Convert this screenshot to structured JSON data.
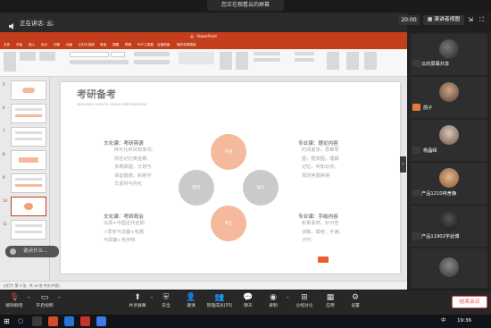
{
  "banner": {
    "text": "您正在观看云的屏幕"
  },
  "meeting": {
    "speaker_text": "正在讲话: 云;",
    "time": "20:00",
    "presenter_view": "演讲者视图",
    "fullscreen_icon": "fullscreen-icon"
  },
  "ppt": {
    "window_title": "云 - PowerPoint",
    "tabs": [
      "文件",
      "开始",
      "插入",
      "设计",
      "切换",
      "动画",
      "幻灯片放映",
      "审阅",
      "视图",
      "帮助",
      "PDF工具集",
      "百度网盘"
    ],
    "tell_me": "操作说明搜索",
    "user_badge": "我在讲话",
    "status_text": "幻灯片 第 9 张，共 16 张    中文(中国)",
    "thumbs": [
      "5",
      "6",
      "7",
      "8",
      "9",
      "10",
      "11"
    ]
  },
  "slide": {
    "title": "考研备考",
    "subtitle": "DEGASED FATHER GRING PREPARATION",
    "circles": {
      "top": "英语",
      "left": "政治",
      "right": "理论",
      "bottom": "专业"
    },
    "blocks": [
      {
        "title": "文化课：考研英语",
        "body": "碎片化时间背单词,\n抓住记忆黄金期,\n多刷真题，计划与\n保证题感，积累作\n文素材与内化"
      },
      {
        "title": "专业课：理论内容",
        "body": "时间紧张，思维导\n图，框架图，理解\n记忆，听知识点，\n规范答题用语"
      },
      {
        "title": "文化课：考研政治",
        "body": "马原+中国近代史纲\n+思修与法基+毛概\n与政策+毛中特"
      },
      {
        "title": "专业课：手绘内容",
        "body": "积累素材，针对性\n训练，模考，手速，\n计时"
      }
    ]
  },
  "overlay": {
    "speaking": "说点什么..."
  },
  "participants": [
    {
      "name": "云的屏幕共享",
      "color": "#2f2f2f"
    },
    {
      "name": "鸽子",
      "color": "#6b4f3b"
    },
    {
      "name": "杨晶晖",
      "color": "#8c6e5a"
    },
    {
      "name": "产品1210林舍静",
      "color": "#5b4536"
    },
    {
      "name": "产品11902宇此博",
      "color": "#2a2a2a"
    },
    {
      "name": "",
      "color": "#4d4d4d"
    }
  ],
  "toolbar": {
    "buttons": [
      {
        "label": "解除静音",
        "icon": "microphone-muted-icon"
      },
      {
        "label": "开启视频",
        "icon": "camera-off-icon"
      },
      {
        "label": "共享屏幕",
        "icon": "share-screen-icon"
      },
      {
        "label": "安全",
        "icon": "shield-icon"
      },
      {
        "label": "邀请",
        "icon": "invite-icon"
      },
      {
        "label": "管理成员(35)",
        "icon": "members-icon"
      },
      {
        "label": "聊天",
        "icon": "chat-icon"
      },
      {
        "label": "录制",
        "icon": "record-icon"
      },
      {
        "label": "分组讨论",
        "icon": "breakout-icon"
      },
      {
        "label": "应用",
        "icon": "apps-icon"
      },
      {
        "label": "设置",
        "icon": "settings-icon"
      }
    ],
    "end": "结束会议"
  },
  "taskbar": {
    "ime": "中",
    "time": "19:36"
  },
  "colors": {
    "accent_orange": "#f5b99b",
    "accent_orange_dark": "#f0a07a",
    "gray_circle": "#c5c5c5",
    "ppt_red": "#c43e1c",
    "end_red": "#e25555"
  }
}
